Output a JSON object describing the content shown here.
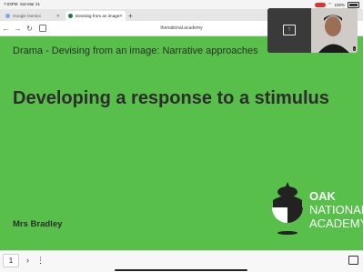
{
  "status": {
    "time": "7:03PM",
    "date": "Sat Mar 21",
    "battery": "100%"
  },
  "tabs": [
    {
      "label": "Google Gemini",
      "active": false
    },
    {
      "label": "Devising from an image",
      "active": true
    }
  ],
  "address": {
    "url": "thenational.academy"
  },
  "slide": {
    "subtitle": "Drama - Devising from an image: Narrative approaches",
    "title": "Developing a response to a stimulus",
    "teacher": "Mrs Bradley",
    "logo_lines": [
      "OAK",
      "NATIONAL",
      "ACADEMY"
    ]
  },
  "toolbar": {
    "page_number": "1"
  },
  "colors": {
    "slide_bg": "#58c04a",
    "text_dark": "#2d2d2d"
  }
}
